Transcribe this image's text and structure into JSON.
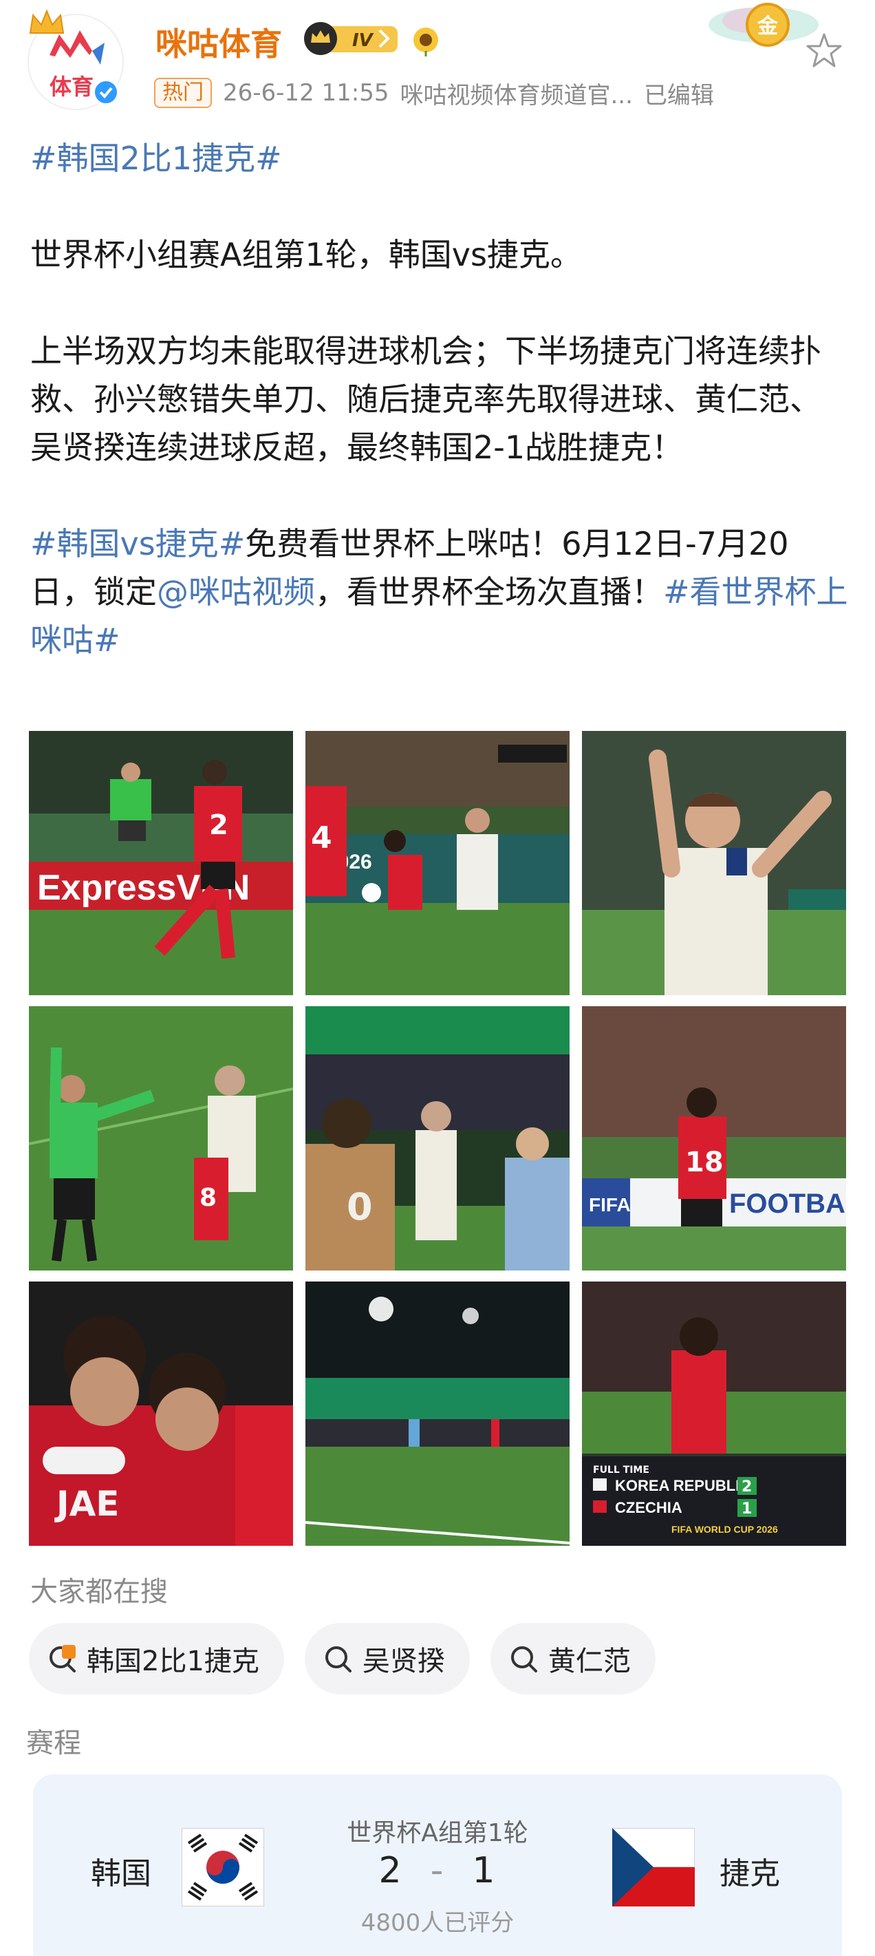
{
  "account": {
    "name": "咪咕体育",
    "avatar_text": "体育",
    "level": "IV",
    "hot_tag": "热门",
    "timestamp": "26-6-12 11:55",
    "source": "咪咕视频体育频道官...",
    "edited": "已编辑",
    "medal_text": "金"
  },
  "post": {
    "hashtag1": "#韩国2比1捷克#",
    "line1": "世界杯小组赛A组第1轮，韩国vs捷克。",
    "para2": "上半场双方均未能取得进球机会；下半场捷克门将连续扑救、孙兴慜错失单刀、随后捷克率先取得进球、黄仁范、吴贤揆连续进球反超，最终韩国2-1战胜捷克！",
    "hashtag2": "#韩国vs捷克#",
    "text3a": "免费看世界杯上咪咕！6月12日-7月20日，锁定",
    "mention": "@咪咕视频",
    "text3b": "，看世界杯全场次直播！",
    "hashtag3": "#看世界杯上咪咕#"
  },
  "images": {
    "img1_board": "ExpressVPN",
    "img2_board": "2026",
    "img6_board": "FOOTBALL",
    "img6_fifa": "FIFA",
    "img9_full_time": "FULL TIME",
    "img9_team1": "KOREA REPUBLIC",
    "img9_score1": "2",
    "img9_team2": "CZECHIA",
    "img9_score2": "1",
    "img9_footer": "FIFA WORLD CUP 2026"
  },
  "search": {
    "label": "大家都在搜",
    "chips": [
      {
        "label": "韩国2比1捷克",
        "icon": "hot-search-icon"
      },
      {
        "label": "吴贤揆",
        "icon": "search-icon"
      },
      {
        "label": "黄仁范",
        "icon": "search-icon"
      }
    ]
  },
  "schedule": {
    "label": "赛程",
    "round": "世界杯A组第1轮",
    "home_team": "韩国",
    "away_team": "捷克",
    "home_score": "2",
    "away_score": "1",
    "separator": "-",
    "rated": "4800人已评分"
  },
  "colors": {
    "accent": "#e8730c",
    "link": "#4a78b5",
    "card_bg": "#eef4fc",
    "chip_bg": "#f3f3f5"
  }
}
